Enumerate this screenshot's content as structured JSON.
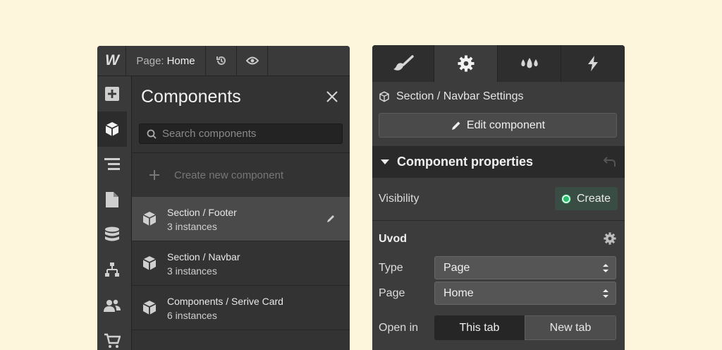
{
  "designer": {
    "logo": "W",
    "page_prefix": "Page:",
    "page_name": "Home",
    "icons": {
      "history": "history-icon",
      "preview": "eye-icon",
      "rail": [
        "add-icon",
        "components-icon",
        "navigator-icon",
        "pages-icon",
        "cms-icon",
        "logic-icon",
        "users-icon",
        "ecommerce-icon"
      ]
    }
  },
  "components_panel": {
    "title": "Components",
    "search_placeholder": "Search components",
    "create_label": "Create new component",
    "items": [
      {
        "name": "Section / Footer",
        "count": "3 instances"
      },
      {
        "name": "Section / Navbar",
        "count": "3 instances"
      },
      {
        "name": "Components / Serive Card",
        "count": "6 instances"
      }
    ]
  },
  "settings_panel": {
    "tabs": [
      "style-brush-icon",
      "settings-gear-icon",
      "interactions-drops-icon",
      "lightning-icon"
    ],
    "header": "Section / Navbar Settings",
    "edit_label": "Edit component",
    "props_title": "Component properties",
    "visibility_label": "Visibility",
    "create_label": "Create",
    "group_title": "Uvod",
    "type_label": "Type",
    "type_value": "Page",
    "page_label": "Page",
    "page_value": "Home",
    "open_in_label": "Open in",
    "open_this": "This tab",
    "open_new": "New tab"
  },
  "colors": {
    "background": "#fdf5dc",
    "panel": "#333333",
    "accent_green": "#2dbd6e"
  }
}
